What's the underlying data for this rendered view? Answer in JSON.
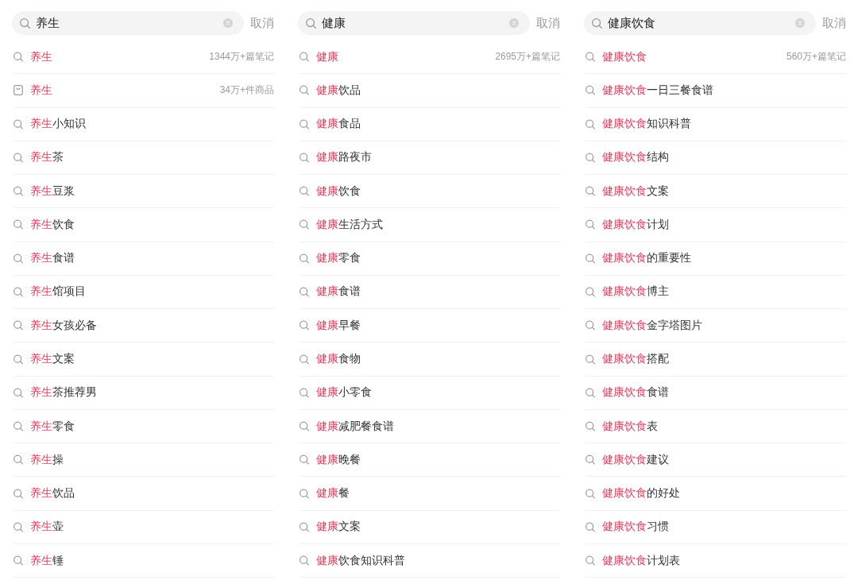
{
  "panels": [
    {
      "search": {
        "value": "养生",
        "cancel": "取消"
      },
      "suggestions": [
        {
          "kind": "keyword",
          "match": "养生",
          "count": "1344万+篇笔记"
        },
        {
          "kind": "product",
          "match": "养生",
          "count": "34万+件商品"
        },
        {
          "kind": "keyword",
          "match": "养生",
          "rest": "小知识"
        },
        {
          "kind": "keyword",
          "match": "养生",
          "rest": "茶"
        },
        {
          "kind": "keyword",
          "match": "养生",
          "rest": "豆浆"
        },
        {
          "kind": "keyword",
          "match": "养生",
          "rest": "饮食"
        },
        {
          "kind": "keyword",
          "match": "养生",
          "rest": "食谱"
        },
        {
          "kind": "keyword",
          "match": "养生",
          "rest": "馆项目"
        },
        {
          "kind": "keyword",
          "match": "养生",
          "rest": "女孩必备"
        },
        {
          "kind": "keyword",
          "match": "养生",
          "rest": "文案"
        },
        {
          "kind": "keyword",
          "match": "养生",
          "rest": "茶推荐男"
        },
        {
          "kind": "keyword",
          "match": "养生",
          "rest": "零食"
        },
        {
          "kind": "keyword",
          "match": "养生",
          "rest": "操"
        },
        {
          "kind": "keyword",
          "match": "养生",
          "rest": "饮品"
        },
        {
          "kind": "keyword",
          "match": "养生",
          "rest": "壶"
        },
        {
          "kind": "keyword",
          "match": "养生",
          "rest": "锤"
        }
      ]
    },
    {
      "search": {
        "value": "健康",
        "cancel": "取消"
      },
      "suggestions": [
        {
          "kind": "keyword",
          "match": "健康",
          "count": "2695万+篇笔记"
        },
        {
          "kind": "keyword",
          "match": "健康",
          "rest": "饮品"
        },
        {
          "kind": "keyword",
          "match": "健康",
          "rest": "食品"
        },
        {
          "kind": "keyword",
          "match": "健康",
          "rest": "路夜市"
        },
        {
          "kind": "keyword",
          "match": "健康",
          "rest": "饮食"
        },
        {
          "kind": "keyword",
          "match": "健康",
          "rest": "生活方式"
        },
        {
          "kind": "keyword",
          "match": "健康",
          "rest": "零食"
        },
        {
          "kind": "keyword",
          "match": "健康",
          "rest": "食谱"
        },
        {
          "kind": "keyword",
          "match": "健康",
          "rest": "早餐"
        },
        {
          "kind": "keyword",
          "match": "健康",
          "rest": "食物"
        },
        {
          "kind": "keyword",
          "match": "健康",
          "rest": "小零食"
        },
        {
          "kind": "keyword",
          "match": "健康",
          "rest": "减肥餐食谱"
        },
        {
          "kind": "keyword",
          "match": "健康",
          "rest": "晚餐"
        },
        {
          "kind": "keyword",
          "match": "健康",
          "rest": "餐"
        },
        {
          "kind": "keyword",
          "match": "健康",
          "rest": "文案"
        },
        {
          "kind": "keyword",
          "match": "健康",
          "rest": "饮食知识科普"
        }
      ]
    },
    {
      "search": {
        "value": "健康饮食",
        "cancel": "取消"
      },
      "suggestions": [
        {
          "kind": "keyword",
          "match": "健康饮食",
          "count": "560万+篇笔记"
        },
        {
          "kind": "keyword",
          "match": "健康饮食",
          "rest": "一日三餐食谱"
        },
        {
          "kind": "keyword",
          "match": "健康饮食",
          "rest": "知识科普"
        },
        {
          "kind": "keyword",
          "match": "健康饮食",
          "rest": "结构"
        },
        {
          "kind": "keyword",
          "match": "健康饮食",
          "rest": "文案"
        },
        {
          "kind": "keyword",
          "match": "健康饮食",
          "rest": "计划"
        },
        {
          "kind": "keyword",
          "match": "健康饮食",
          "rest": "的重要性"
        },
        {
          "kind": "keyword",
          "match": "健康饮食",
          "rest": "博主"
        },
        {
          "kind": "keyword",
          "match": "健康饮食",
          "rest": "金字塔图片"
        },
        {
          "kind": "keyword",
          "match": "健康饮食",
          "rest": "搭配"
        },
        {
          "kind": "keyword",
          "match": "健康饮食",
          "rest": "食谱"
        },
        {
          "kind": "keyword",
          "match": "健康饮食",
          "rest": "表"
        },
        {
          "kind": "keyword",
          "match": "健康饮食",
          "rest": "建议"
        },
        {
          "kind": "keyword",
          "match": "健康饮食",
          "rest": "的好处"
        },
        {
          "kind": "keyword",
          "match": "健康饮食",
          "rest": "习惯"
        },
        {
          "kind": "keyword",
          "match": "健康饮食",
          "rest": "计划表"
        }
      ]
    }
  ]
}
